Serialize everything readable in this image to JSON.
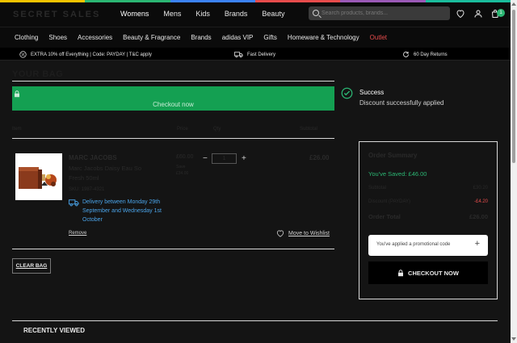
{
  "brand": {
    "logo_text": "SECRET SALES"
  },
  "colors": {
    "stripe": [
      "#f5c400",
      "#2bb673",
      "#3b82f6",
      "#e74c4c",
      "#9b59b6",
      "#1abc9c"
    ],
    "accent_green": "#14a052",
    "link_blue": "#4aa3e8",
    "outlet_red": "#e74c4c"
  },
  "header": {
    "nav": [
      "Womens",
      "Mens",
      "Kids",
      "Brands",
      "Beauty"
    ],
    "search_placeholder": "Search products, brands...",
    "icons": [
      "heart-icon",
      "user-icon",
      "bag-icon"
    ],
    "cart_count": "1"
  },
  "subnav": [
    "Clothing",
    "Shoes",
    "Accessories",
    "Beauty & Fragrance",
    "Brands",
    "adidas VIP",
    "Gifts",
    "Homeware & Technology",
    "Outlet"
  ],
  "promo": {
    "offer": "EXTRA 10% off Everything | Code: PAYDAY | T&C apply",
    "delivery": "Fast Delivery",
    "returns": "60 Day Returns"
  },
  "bag": {
    "title": "YOUR BAG",
    "checkout_label": "Checkout now",
    "headers": {
      "item": "Item",
      "price": "Price",
      "qty": "Qty",
      "subtotal": "Subtotal"
    },
    "item": {
      "brand": "MARC JACOBS",
      "name": "Marc Jacobs Daisy Eau So Fresh 50ml",
      "sku": "SKU: 1987-4321",
      "price_old": "£60.00",
      "price_save": "Save\n£34.00",
      "qty": "1",
      "total": "£26.00",
      "delivery": "Delivery between Monday 29th September and Wednesday 1st October",
      "remove_label": "Remove",
      "wishlist_label": "Move to Wishlist"
    },
    "clear_label": "CLEAR BAG"
  },
  "notice": {
    "title": "Success",
    "message": "Discount successfully applied"
  },
  "summary": {
    "title": "Order Summary",
    "saved": "You've Saved: £46.00",
    "subtotal_label": "Subtotal",
    "subtotal_value": "£30.20",
    "discount_label": "Discount (PAYDAY)",
    "discount_value": "-£4.20",
    "total_label": "Order Total",
    "total_value": "£26.00",
    "promo_text": "You've applied a promotional code",
    "promo_icon": "+",
    "checkout_label": "CHECKOUT NOW"
  },
  "recently_viewed": {
    "title": "RECENTLY VIEWED"
  }
}
